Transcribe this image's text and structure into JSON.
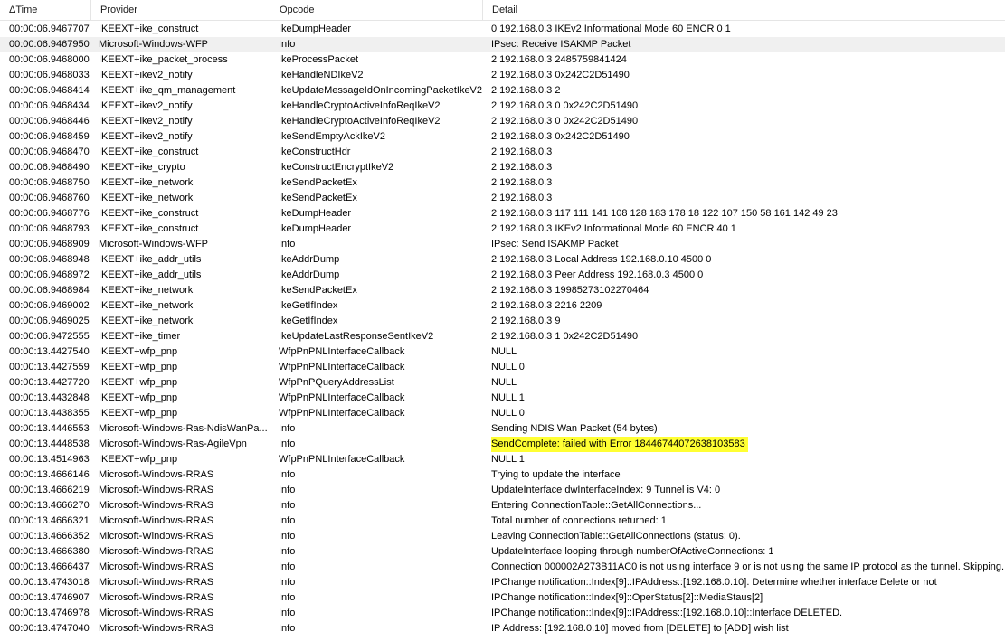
{
  "columns": [
    "ΔTime",
    "Provider",
    "Opcode",
    "Detail"
  ],
  "highlight_color": "#ffff33",
  "rows": [
    {
      "time": "00:00:06.9467707",
      "provider": "IKEEXT+ike_construct",
      "opcode": "IkeDumpHeader",
      "detail": "0 192.168.0.3 IKEv2 Informational Mode 60 ENCR 0 1"
    },
    {
      "time": "00:00:06.9467950",
      "provider": "Microsoft-Windows-WFP",
      "opcode": "Info",
      "detail": "IPsec: Receive ISAKMP Packet",
      "selected": true
    },
    {
      "time": "00:00:06.9468000",
      "provider": "IKEEXT+ike_packet_process",
      "opcode": "IkeProcessPacket",
      "detail": "2 192.168.0.3 2485759841424"
    },
    {
      "time": "00:00:06.9468033",
      "provider": "IKEEXT+ikev2_notify",
      "opcode": "IkeHandleNDIkeV2",
      "detail": "2 192.168.0.3 0x242C2D51490"
    },
    {
      "time": "00:00:06.9468414",
      "provider": "IKEEXT+ike_qm_management",
      "opcode": "IkeUpdateMessageIdOnIncomingPacketIkeV2",
      "detail": "2 192.168.0.3 2"
    },
    {
      "time": "00:00:06.9468434",
      "provider": "IKEEXT+ikev2_notify",
      "opcode": "IkeHandleCryptoActiveInfoReqIkeV2",
      "detail": "2 192.168.0.3 0 0x242C2D51490"
    },
    {
      "time": "00:00:06.9468446",
      "provider": "IKEEXT+ikev2_notify",
      "opcode": "IkeHandleCryptoActiveInfoReqIkeV2",
      "detail": "2 192.168.0.3 0 0x242C2D51490"
    },
    {
      "time": "00:00:06.9468459",
      "provider": "IKEEXT+ikev2_notify",
      "opcode": "IkeSendEmptyAckIkeV2",
      "detail": "2 192.168.0.3 0x242C2D51490"
    },
    {
      "time": "00:00:06.9468470",
      "provider": "IKEEXT+ike_construct",
      "opcode": "IkeConstructHdr",
      "detail": "2 192.168.0.3"
    },
    {
      "time": "00:00:06.9468490",
      "provider": "IKEEXT+ike_crypto",
      "opcode": "IkeConstructEncryptIkeV2",
      "detail": "2 192.168.0.3"
    },
    {
      "time": "00:00:06.9468750",
      "provider": "IKEEXT+ike_network",
      "opcode": "IkeSendPacketEx",
      "detail": "2 192.168.0.3"
    },
    {
      "time": "00:00:06.9468760",
      "provider": "IKEEXT+ike_network",
      "opcode": "IkeSendPacketEx",
      "detail": "2 192.168.0.3"
    },
    {
      "time": "00:00:06.9468776",
      "provider": "IKEEXT+ike_construct",
      "opcode": "IkeDumpHeader",
      "detail": "2 192.168.0.3 117 111 141 108 128 183 178 18 122 107 150 58 161 142 49 23"
    },
    {
      "time": "00:00:06.9468793",
      "provider": "IKEEXT+ike_construct",
      "opcode": "IkeDumpHeader",
      "detail": "2 192.168.0.3 IKEv2 Informational Mode 60 ENCR 40 1"
    },
    {
      "time": "00:00:06.9468909",
      "provider": "Microsoft-Windows-WFP",
      "opcode": "Info",
      "detail": "IPsec: Send ISAKMP Packet"
    },
    {
      "time": "00:00:06.9468948",
      "provider": "IKEEXT+ike_addr_utils",
      "opcode": "IkeAddrDump",
      "detail": "2 192.168.0.3 Local Address 192.168.0.10 4500 0"
    },
    {
      "time": "00:00:06.9468972",
      "provider": "IKEEXT+ike_addr_utils",
      "opcode": "IkeAddrDump",
      "detail": "2 192.168.0.3 Peer Address 192.168.0.3 4500 0"
    },
    {
      "time": "00:00:06.9468984",
      "provider": "IKEEXT+ike_network",
      "opcode": "IkeSendPacketEx",
      "detail": "2 192.168.0.3 19985273102270464"
    },
    {
      "time": "00:00:06.9469002",
      "provider": "IKEEXT+ike_network",
      "opcode": "IkeGetIfIndex",
      "detail": "2 192.168.0.3 2216 2209"
    },
    {
      "time": "00:00:06.9469025",
      "provider": "IKEEXT+ike_network",
      "opcode": "IkeGetIfIndex",
      "detail": "2 192.168.0.3 9"
    },
    {
      "time": "00:00:06.9472555",
      "provider": "IKEEXT+ike_timer",
      "opcode": "IkeUpdateLastResponseSentIkeV2",
      "detail": "2 192.168.0.3 1 0x242C2D51490"
    },
    {
      "time": "00:00:13.4427540",
      "provider": "IKEEXT+wfp_pnp",
      "opcode": "WfpPnPNLInterfaceCallback",
      "detail": "NULL"
    },
    {
      "time": "00:00:13.4427559",
      "provider": "IKEEXT+wfp_pnp",
      "opcode": "WfpPnPNLInterfaceCallback",
      "detail": "NULL 0"
    },
    {
      "time": "00:00:13.4427720",
      "provider": "IKEEXT+wfp_pnp",
      "opcode": "WfpPnPQueryAddressList",
      "detail": "NULL"
    },
    {
      "time": "00:00:13.4432848",
      "provider": "IKEEXT+wfp_pnp",
      "opcode": "WfpPnPNLInterfaceCallback",
      "detail": "NULL 1"
    },
    {
      "time": "00:00:13.4438355",
      "provider": "IKEEXT+wfp_pnp",
      "opcode": "WfpPnPNLInterfaceCallback",
      "detail": "NULL 0"
    },
    {
      "time": "00:00:13.4446553",
      "provider": "Microsoft-Windows-Ras-NdisWanPa...",
      "opcode": "Info",
      "detail": "Sending NDIS Wan Packet (54 bytes)"
    },
    {
      "time": "00:00:13.4448538",
      "provider": "Microsoft-Windows-Ras-AgileVpn",
      "opcode": "Info",
      "detail": "SendComplete: failed with Error 18446744072638103583",
      "highlight": true
    },
    {
      "time": "00:00:13.4514963",
      "provider": "IKEEXT+wfp_pnp",
      "opcode": "WfpPnPNLInterfaceCallback",
      "detail": "NULL 1"
    },
    {
      "time": "00:00:13.4666146",
      "provider": "Microsoft-Windows-RRAS",
      "opcode": "Info",
      "detail": "Trying to update the interface"
    },
    {
      "time": "00:00:13.4666219",
      "provider": "Microsoft-Windows-RRAS",
      "opcode": "Info",
      "detail": "UpdateInterface dwInterfaceIndex: 9 Tunnel is V4: 0"
    },
    {
      "time": "00:00:13.4666270",
      "provider": "Microsoft-Windows-RRAS",
      "opcode": "Info",
      "detail": "Entering ConnectionTable::GetAllConnections..."
    },
    {
      "time": "00:00:13.4666321",
      "provider": "Microsoft-Windows-RRAS",
      "opcode": "Info",
      "detail": "Total number of connections returned: 1"
    },
    {
      "time": "00:00:13.4666352",
      "provider": "Microsoft-Windows-RRAS",
      "opcode": "Info",
      "detail": "Leaving ConnectionTable::GetAllConnections (status: 0)."
    },
    {
      "time": "00:00:13.4666380",
      "provider": "Microsoft-Windows-RRAS",
      "opcode": "Info",
      "detail": "UpdateInterface looping through numberOfActiveConnections: 1"
    },
    {
      "time": "00:00:13.4666437",
      "provider": "Microsoft-Windows-RRAS",
      "opcode": "Info",
      "detail": "Connection 000002A273B11AC0 is not using interface 9 or is not using the same IP protocol as the tunnel. Skipping."
    },
    {
      "time": "00:00:13.4743018",
      "provider": "Microsoft-Windows-RRAS",
      "opcode": "Info",
      "detail": "IPChange notification::Index[9]::IPAddress::[192.168.0.10]. Determine whether interface Delete or not"
    },
    {
      "time": "00:00:13.4746907",
      "provider": "Microsoft-Windows-RRAS",
      "opcode": "Info",
      "detail": "IPChange notification::Index[9]::OperStatus[2]::MediaStaus[2]"
    },
    {
      "time": "00:00:13.4746978",
      "provider": "Microsoft-Windows-RRAS",
      "opcode": "Info",
      "detail": "IPChange notification::Index[9]::IPAddress::[192.168.0.10]::Interface DELETED."
    },
    {
      "time": "00:00:13.4747040",
      "provider": "Microsoft-Windows-RRAS",
      "opcode": "Info",
      "detail": "IP Address: [192.168.0.10] moved from [DELETE] to [ADD] wish list"
    }
  ]
}
